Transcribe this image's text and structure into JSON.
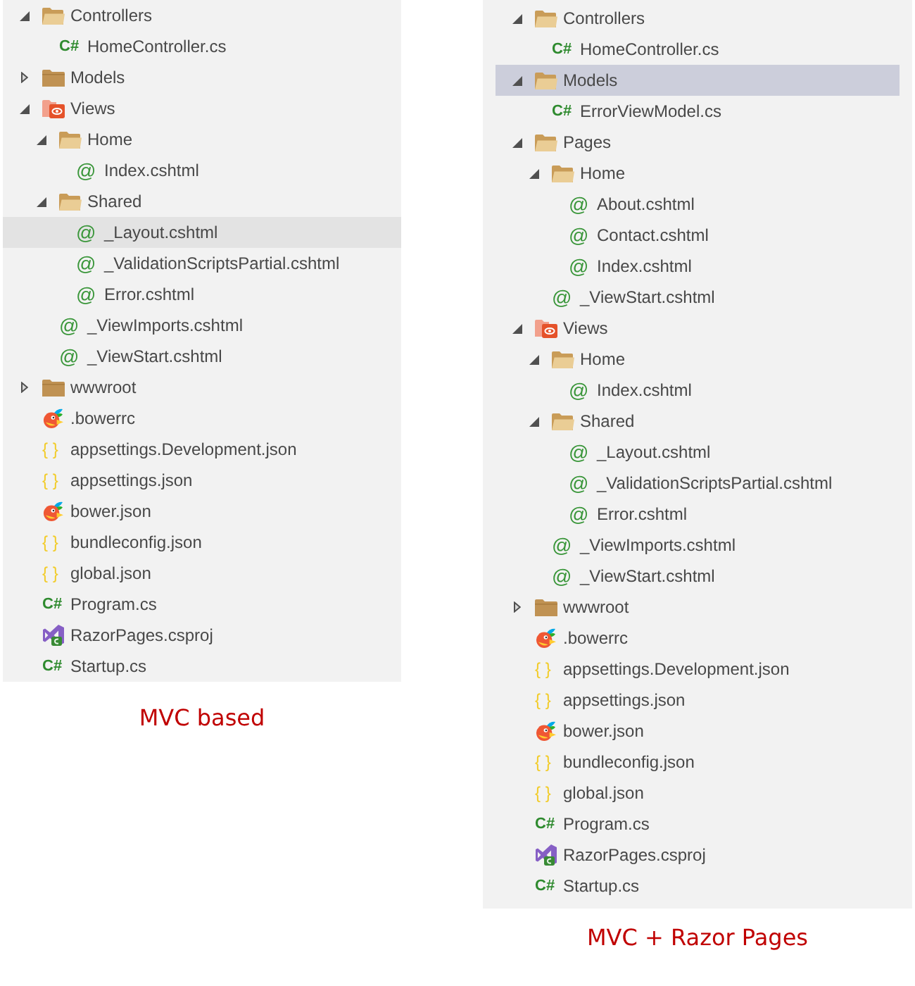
{
  "panels": [
    {
      "caption": "MVC based",
      "items": [
        {
          "kind": "folder",
          "label": "Controllers",
          "expanded": true,
          "selected": false,
          "hovered": false,
          "children": [
            {
              "kind": "cs",
              "glyph": "C#",
              "label": "HomeController.cs",
              "selected": false,
              "hovered": false
            }
          ]
        },
        {
          "kind": "folder",
          "label": "Models",
          "expanded": false,
          "selected": false,
          "hovered": false
        },
        {
          "kind": "views-folder",
          "label": "Views",
          "expanded": true,
          "selected": false,
          "hovered": false,
          "children": [
            {
              "kind": "folder",
              "label": "Home",
              "expanded": true,
              "selected": false,
              "hovered": false,
              "children": [
                {
                  "kind": "razor",
                  "glyph": "@",
                  "label": "Index.cshtml",
                  "selected": false,
                  "hovered": false
                }
              ]
            },
            {
              "kind": "folder",
              "label": "Shared",
              "expanded": true,
              "selected": false,
              "hovered": false,
              "children": [
                {
                  "kind": "razor",
                  "glyph": "@",
                  "label": "_Layout.cshtml",
                  "selected": false,
                  "hovered": true
                },
                {
                  "kind": "razor",
                  "glyph": "@",
                  "label": "_ValidationScriptsPartial.cshtml",
                  "selected": false,
                  "hovered": false
                },
                {
                  "kind": "razor",
                  "glyph": "@",
                  "label": "Error.cshtml",
                  "selected": false,
                  "hovered": false
                }
              ]
            },
            {
              "kind": "razor",
              "glyph": "@",
              "label": "_ViewImports.cshtml",
              "selected": false,
              "hovered": false
            },
            {
              "kind": "razor",
              "glyph": "@",
              "label": "_ViewStart.cshtml",
              "selected": false,
              "hovered": false
            }
          ]
        },
        {
          "kind": "folder",
          "label": "wwwroot",
          "expanded": false,
          "selected": false,
          "hovered": false
        },
        {
          "kind": "bower",
          "label": ".bowerrc",
          "selected": false,
          "hovered": false
        },
        {
          "kind": "json",
          "glyph": "{ }",
          "label": "appsettings.Development.json",
          "selected": false,
          "hovered": false
        },
        {
          "kind": "json",
          "glyph": "{ }",
          "label": "appsettings.json",
          "selected": false,
          "hovered": false
        },
        {
          "kind": "bower",
          "label": "bower.json",
          "selected": false,
          "hovered": false
        },
        {
          "kind": "json",
          "glyph": "{ }",
          "label": "bundleconfig.json",
          "selected": false,
          "hovered": false
        },
        {
          "kind": "json",
          "glyph": "{ }",
          "label": "global.json",
          "selected": false,
          "hovered": false
        },
        {
          "kind": "cs",
          "glyph": "C#",
          "label": "Program.cs",
          "selected": false,
          "hovered": false
        },
        {
          "kind": "csproj",
          "label": "RazorPages.csproj",
          "selected": false,
          "hovered": false
        },
        {
          "kind": "cs",
          "glyph": "C#",
          "label": "Startup.cs",
          "selected": false,
          "hovered": false
        }
      ]
    },
    {
      "caption": "MVC + Razor Pages",
      "items": [
        {
          "kind": "folder",
          "label": "Controllers",
          "expanded": true,
          "selected": false,
          "hovered": false,
          "children": [
            {
              "kind": "cs",
              "glyph": "C#",
              "label": "HomeController.cs",
              "selected": false,
              "hovered": false
            }
          ]
        },
        {
          "kind": "folder",
          "label": "Models",
          "expanded": true,
          "selected": true,
          "hovered": false,
          "children": [
            {
              "kind": "cs",
              "glyph": "C#",
              "label": "ErrorViewModel.cs",
              "selected": false,
              "hovered": false
            }
          ]
        },
        {
          "kind": "folder",
          "label": "Pages",
          "expanded": true,
          "selected": false,
          "hovered": false,
          "children": [
            {
              "kind": "folder",
              "label": "Home",
              "expanded": true,
              "selected": false,
              "hovered": false,
              "children": [
                {
                  "kind": "razor",
                  "glyph": "@",
                  "label": "About.cshtml",
                  "selected": false,
                  "hovered": false
                },
                {
                  "kind": "razor",
                  "glyph": "@",
                  "label": "Contact.cshtml",
                  "selected": false,
                  "hovered": false
                },
                {
                  "kind": "razor",
                  "glyph": "@",
                  "label": "Index.cshtml",
                  "selected": false,
                  "hovered": false
                }
              ]
            },
            {
              "kind": "razor",
              "glyph": "@",
              "label": "_ViewStart.cshtml",
              "selected": false,
              "hovered": false
            }
          ]
        },
        {
          "kind": "views-folder",
          "label": "Views",
          "expanded": true,
          "selected": false,
          "hovered": false,
          "children": [
            {
              "kind": "folder",
              "label": "Home",
              "expanded": true,
              "selected": false,
              "hovered": false,
              "children": [
                {
                  "kind": "razor",
                  "glyph": "@",
                  "label": "Index.cshtml",
                  "selected": false,
                  "hovered": false
                }
              ]
            },
            {
              "kind": "folder",
              "label": "Shared",
              "expanded": true,
              "selected": false,
              "hovered": false,
              "children": [
                {
                  "kind": "razor",
                  "glyph": "@",
                  "label": "_Layout.cshtml",
                  "selected": false,
                  "hovered": false
                },
                {
                  "kind": "razor",
                  "glyph": "@",
                  "label": "_ValidationScriptsPartial.cshtml",
                  "selected": false,
                  "hovered": false
                },
                {
                  "kind": "razor",
                  "glyph": "@",
                  "label": "Error.cshtml",
                  "selected": false,
                  "hovered": false
                }
              ]
            },
            {
              "kind": "razor",
              "glyph": "@",
              "label": "_ViewImports.cshtml",
              "selected": false,
              "hovered": false
            },
            {
              "kind": "razor",
              "glyph": "@",
              "label": "_ViewStart.cshtml",
              "selected": false,
              "hovered": false
            }
          ]
        },
        {
          "kind": "folder",
          "label": "wwwroot",
          "expanded": false,
          "selected": false,
          "hovered": false
        },
        {
          "kind": "bower",
          "label": ".bowerrc",
          "selected": false,
          "hovered": false
        },
        {
          "kind": "json",
          "glyph": "{ }",
          "label": "appsettings.Development.json",
          "selected": false,
          "hovered": false
        },
        {
          "kind": "json",
          "glyph": "{ }",
          "label": "appsettings.json",
          "selected": false,
          "hovered": false
        },
        {
          "kind": "bower",
          "label": "bower.json",
          "selected": false,
          "hovered": false
        },
        {
          "kind": "json",
          "glyph": "{ }",
          "label": "bundleconfig.json",
          "selected": false,
          "hovered": false
        },
        {
          "kind": "json",
          "glyph": "{ }",
          "label": "global.json",
          "selected": false,
          "hovered": false
        },
        {
          "kind": "cs",
          "glyph": "C#",
          "label": "Program.cs",
          "selected": false,
          "hovered": false
        },
        {
          "kind": "csproj",
          "label": "RazorPages.csproj",
          "selected": false,
          "hovered": false
        },
        {
          "kind": "cs",
          "glyph": "C#",
          "label": "Startup.cs",
          "selected": false,
          "hovered": false
        }
      ]
    }
  ]
}
